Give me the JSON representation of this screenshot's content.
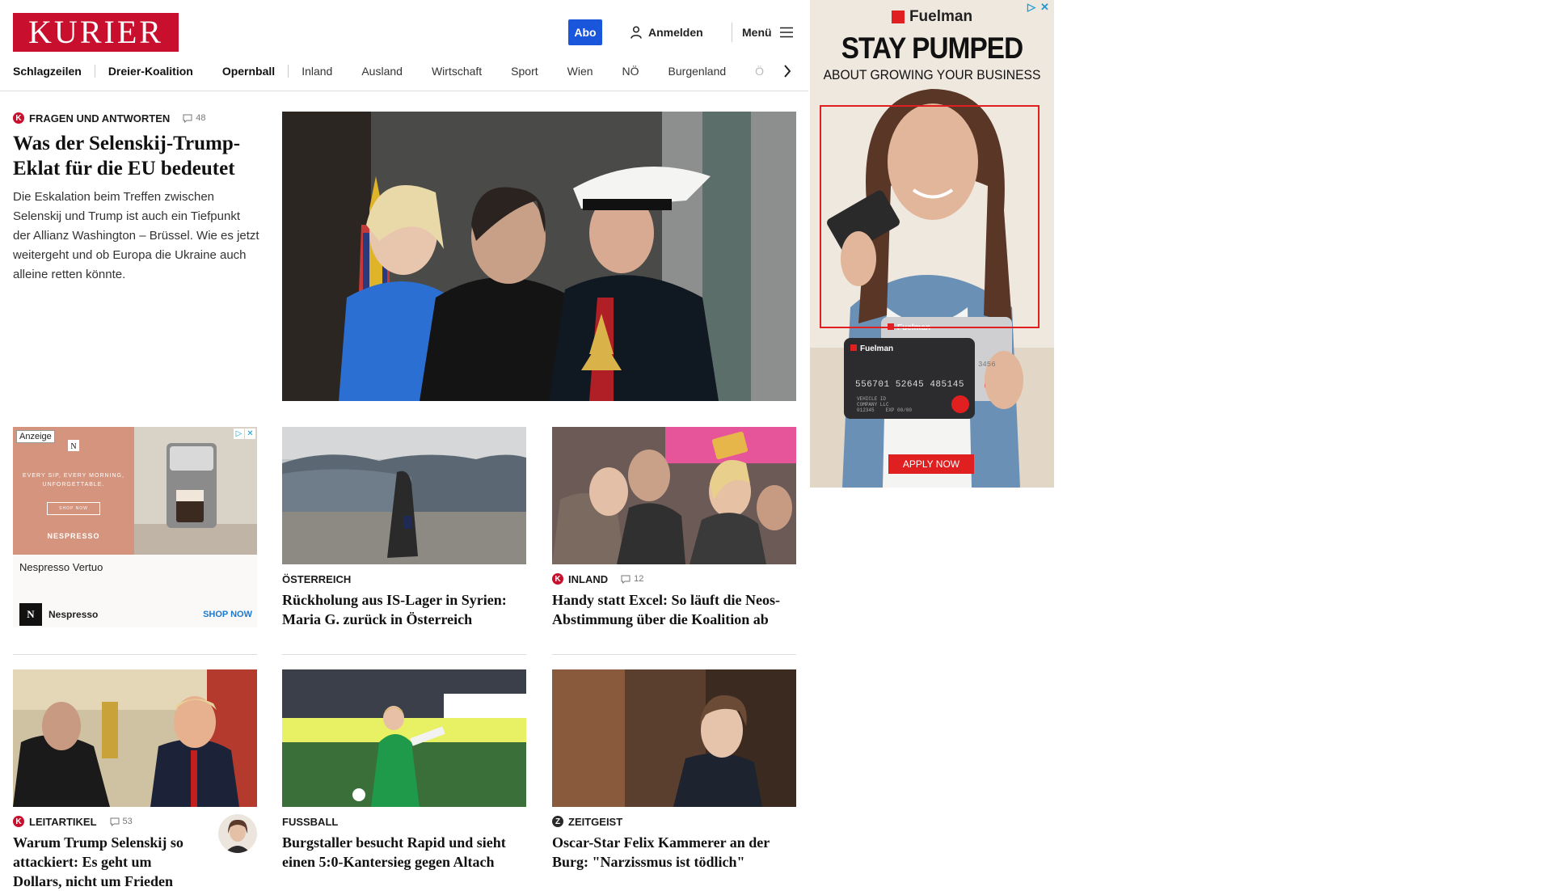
{
  "header": {
    "logo": "KURIER",
    "abo_label": "Abo",
    "login_label": "Anmelden",
    "menu_label": "Menü"
  },
  "nav": {
    "items": [
      "Schlagzeilen",
      "Dreier-Koalition",
      "Opernball",
      "Inland",
      "Ausland",
      "Wirtschaft",
      "Sport",
      "Wien",
      "NÖ",
      "Burgenland"
    ],
    "overflow_item": "Ö"
  },
  "lead": {
    "kicker": "FRAGEN UND ANTWORTEN",
    "comments": "48",
    "title": "Was der Selenskij-Trump-Eklat für die EU bedeutet",
    "body": "Die Eskalation beim Treffen zwischen Selenskij und Trump ist auch ein Tiefpunkt der Allianz Washington – Brüssel. Wie es jetzt weitergeht und ob Europa die Ukraine auch alleine retten könnte."
  },
  "ad_nespresso": {
    "label": "Anzeige",
    "slogan": "EVERY SIP, EVERY MORNING, UNFORGETTABLE.",
    "shop_small": "SHOP NOW",
    "logo_text": "NESPRESSO",
    "product": "Nespresso Vertuo",
    "brand": "Nespresso",
    "brand_initial": "N",
    "cta": "SHOP NOW"
  },
  "cards": [
    {
      "kicker": "ÖSTERREICH",
      "title": "Rückholung aus IS-Lager in Syrien: Maria G. zurück in Österreich"
    },
    {
      "kicker": "INLAND",
      "comments": "12",
      "title": "Handy statt Excel: So läuft die Neos-Abstimmung über die Koalition ab"
    },
    {
      "kicker": "LEITARTIKEL",
      "comments": "53",
      "title": "Warum Trump Selenskij so attackiert: Es geht um Dollars, nicht um Frieden"
    },
    {
      "kicker": "FUSSBALL",
      "title": "Burgstaller besucht Rapid und sieht einen 5:0-Kantersieg gegen Altach"
    },
    {
      "kicker": "ZEITGEIST",
      "title": "Oscar-Star Felix Kammerer an der Burg: \"Narzissmus ist tödlich\""
    }
  ],
  "ad_fuelman": {
    "brand": "Fuelman",
    "headline": "STAY PUMPED",
    "subheadline": "ABOUT GROWING YOUR BUSINESS",
    "card_number": "556701 52645 485145",
    "card_small": "3456",
    "card_lines": [
      "VEHICLE ID",
      "COMPANY LLC",
      "012345",
      "EXP 00/00"
    ],
    "cta": "APPLY NOW"
  },
  "icons": {
    "kurier_badge": "K",
    "zeitgeist_badge": "Z"
  },
  "colors": {
    "brand_red": "#c8102e",
    "abo_blue": "#1a56db",
    "ad_red": "#e02020",
    "link_blue": "#1a7ad1"
  }
}
